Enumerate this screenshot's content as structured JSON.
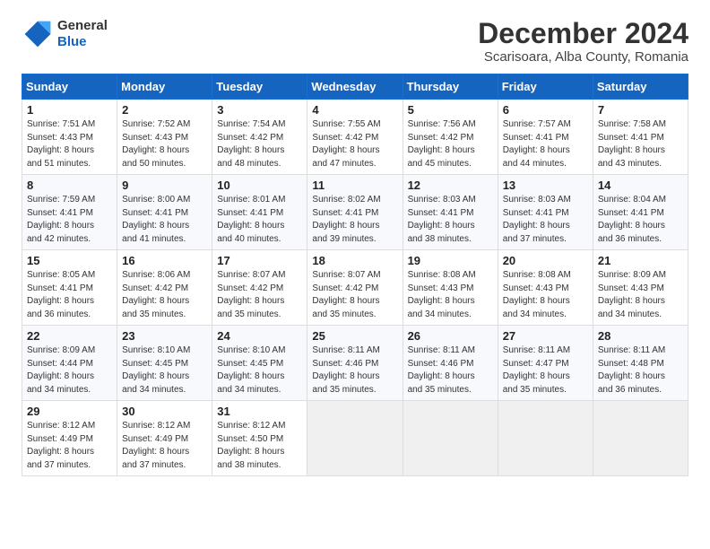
{
  "header": {
    "logo_general": "General",
    "logo_blue": "Blue",
    "month_title": "December 2024",
    "location": "Scarisoara, Alba County, Romania"
  },
  "calendar": {
    "days_of_week": [
      "Sunday",
      "Monday",
      "Tuesday",
      "Wednesday",
      "Thursday",
      "Friday",
      "Saturday"
    ],
    "weeks": [
      [
        null,
        null,
        null,
        null,
        null,
        null,
        null
      ]
    ],
    "cells": [
      {
        "day": null
      },
      {
        "day": null
      },
      {
        "day": null
      },
      {
        "day": null
      },
      {
        "day": null
      },
      {
        "day": null
      },
      {
        "day": null
      }
    ]
  },
  "days": [
    {
      "num": "1",
      "sunrise": "7:51 AM",
      "sunset": "4:43 PM",
      "daylight": "8 hours and 51 minutes."
    },
    {
      "num": "2",
      "sunrise": "7:52 AM",
      "sunset": "4:43 PM",
      "daylight": "8 hours and 50 minutes."
    },
    {
      "num": "3",
      "sunrise": "7:54 AM",
      "sunset": "4:42 PM",
      "daylight": "8 hours and 48 minutes."
    },
    {
      "num": "4",
      "sunrise": "7:55 AM",
      "sunset": "4:42 PM",
      "daylight": "8 hours and 47 minutes."
    },
    {
      "num": "5",
      "sunrise": "7:56 AM",
      "sunset": "4:42 PM",
      "daylight": "8 hours and 45 minutes."
    },
    {
      "num": "6",
      "sunrise": "7:57 AM",
      "sunset": "4:41 PM",
      "daylight": "8 hours and 44 minutes."
    },
    {
      "num": "7",
      "sunrise": "7:58 AM",
      "sunset": "4:41 PM",
      "daylight": "8 hours and 43 minutes."
    },
    {
      "num": "8",
      "sunrise": "7:59 AM",
      "sunset": "4:41 PM",
      "daylight": "8 hours and 42 minutes."
    },
    {
      "num": "9",
      "sunrise": "8:00 AM",
      "sunset": "4:41 PM",
      "daylight": "8 hours and 41 minutes."
    },
    {
      "num": "10",
      "sunrise": "8:01 AM",
      "sunset": "4:41 PM",
      "daylight": "8 hours and 40 minutes."
    },
    {
      "num": "11",
      "sunrise": "8:02 AM",
      "sunset": "4:41 PM",
      "daylight": "8 hours and 39 minutes."
    },
    {
      "num": "12",
      "sunrise": "8:03 AM",
      "sunset": "4:41 PM",
      "daylight": "8 hours and 38 minutes."
    },
    {
      "num": "13",
      "sunrise": "8:03 AM",
      "sunset": "4:41 PM",
      "daylight": "8 hours and 37 minutes."
    },
    {
      "num": "14",
      "sunrise": "8:04 AM",
      "sunset": "4:41 PM",
      "daylight": "8 hours and 36 minutes."
    },
    {
      "num": "15",
      "sunrise": "8:05 AM",
      "sunset": "4:41 PM",
      "daylight": "8 hours and 36 minutes."
    },
    {
      "num": "16",
      "sunrise": "8:06 AM",
      "sunset": "4:42 PM",
      "daylight": "8 hours and 35 minutes."
    },
    {
      "num": "17",
      "sunrise": "8:07 AM",
      "sunset": "4:42 PM",
      "daylight": "8 hours and 35 minutes."
    },
    {
      "num": "18",
      "sunrise": "8:07 AM",
      "sunset": "4:42 PM",
      "daylight": "8 hours and 35 minutes."
    },
    {
      "num": "19",
      "sunrise": "8:08 AM",
      "sunset": "4:43 PM",
      "daylight": "8 hours and 34 minutes."
    },
    {
      "num": "20",
      "sunrise": "8:08 AM",
      "sunset": "4:43 PM",
      "daylight": "8 hours and 34 minutes."
    },
    {
      "num": "21",
      "sunrise": "8:09 AM",
      "sunset": "4:43 PM",
      "daylight": "8 hours and 34 minutes."
    },
    {
      "num": "22",
      "sunrise": "8:09 AM",
      "sunset": "4:44 PM",
      "daylight": "8 hours and 34 minutes."
    },
    {
      "num": "23",
      "sunrise": "8:10 AM",
      "sunset": "4:45 PM",
      "daylight": "8 hours and 34 minutes."
    },
    {
      "num": "24",
      "sunrise": "8:10 AM",
      "sunset": "4:45 PM",
      "daylight": "8 hours and 34 minutes."
    },
    {
      "num": "25",
      "sunrise": "8:11 AM",
      "sunset": "4:46 PM",
      "daylight": "8 hours and 35 minutes."
    },
    {
      "num": "26",
      "sunrise": "8:11 AM",
      "sunset": "4:46 PM",
      "daylight": "8 hours and 35 minutes."
    },
    {
      "num": "27",
      "sunrise": "8:11 AM",
      "sunset": "4:47 PM",
      "daylight": "8 hours and 35 minutes."
    },
    {
      "num": "28",
      "sunrise": "8:11 AM",
      "sunset": "4:48 PM",
      "daylight": "8 hours and 36 minutes."
    },
    {
      "num": "29",
      "sunrise": "8:12 AM",
      "sunset": "4:49 PM",
      "daylight": "8 hours and 37 minutes."
    },
    {
      "num": "30",
      "sunrise": "8:12 AM",
      "sunset": "4:49 PM",
      "daylight": "8 hours and 37 minutes."
    },
    {
      "num": "31",
      "sunrise": "8:12 AM",
      "sunset": "4:50 PM",
      "daylight": "8 hours and 38 minutes."
    }
  ],
  "labels": {
    "sunrise": "Sunrise:",
    "sunset": "Sunset:",
    "daylight": "Daylight:"
  }
}
